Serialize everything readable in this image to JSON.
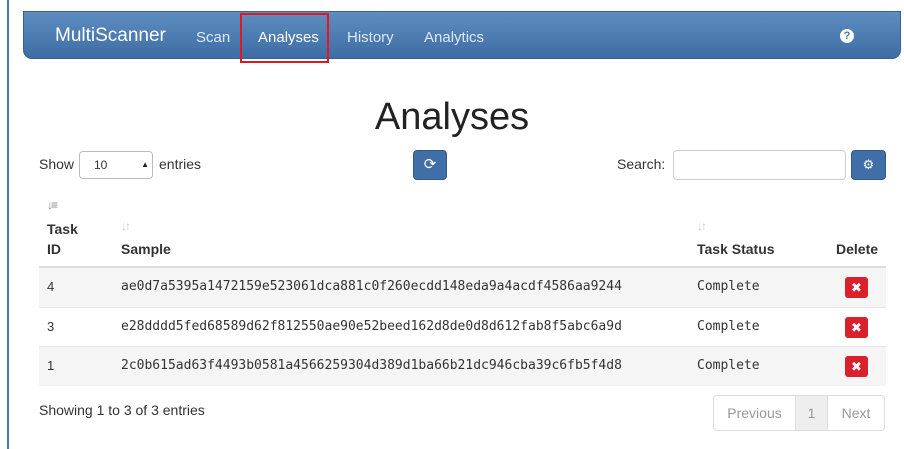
{
  "navbar": {
    "brand": "MultiScanner",
    "links": [
      "Scan",
      "Analyses",
      "History",
      "Analytics"
    ],
    "active": "Analyses",
    "help_icon": "?"
  },
  "page": {
    "title": "Analyses"
  },
  "controls": {
    "show_label": "Show",
    "page_length": "10",
    "entries_label": "entries",
    "refresh_icon": "refresh-icon",
    "search_label": "Search:",
    "search_value": "",
    "settings_icon": "gear-icon"
  },
  "table": {
    "columns": [
      "Task ID",
      "Sample",
      "Task Status",
      "Delete"
    ],
    "rows": [
      {
        "task_id": "4",
        "sample": "ae0d7a5395a1472159e523061dca881c0f260ecdd148eda9a4acdf4586aa9244",
        "status": "Complete"
      },
      {
        "task_id": "3",
        "sample": "e28dddd5fed68589d62f812550ae90e52beed162d8de0d8d612fab8f5abc6a9d",
        "status": "Complete"
      },
      {
        "task_id": "1",
        "sample": "2c0b615ad63f4493b0581a4566259304d389d1ba66b21dc946cba39c6fb5f4d8",
        "status": "Complete"
      }
    ],
    "delete_symbol": "✖"
  },
  "footer": {
    "info": "Showing 1 to 3 of 3 entries",
    "previous": "Previous",
    "current_page": "1",
    "next": "Next"
  },
  "colors": {
    "navbar": "#4a7ab5",
    "primary_button": "#3f6fa6",
    "danger_button": "#d9202b",
    "highlight_box": "#e0191f"
  }
}
